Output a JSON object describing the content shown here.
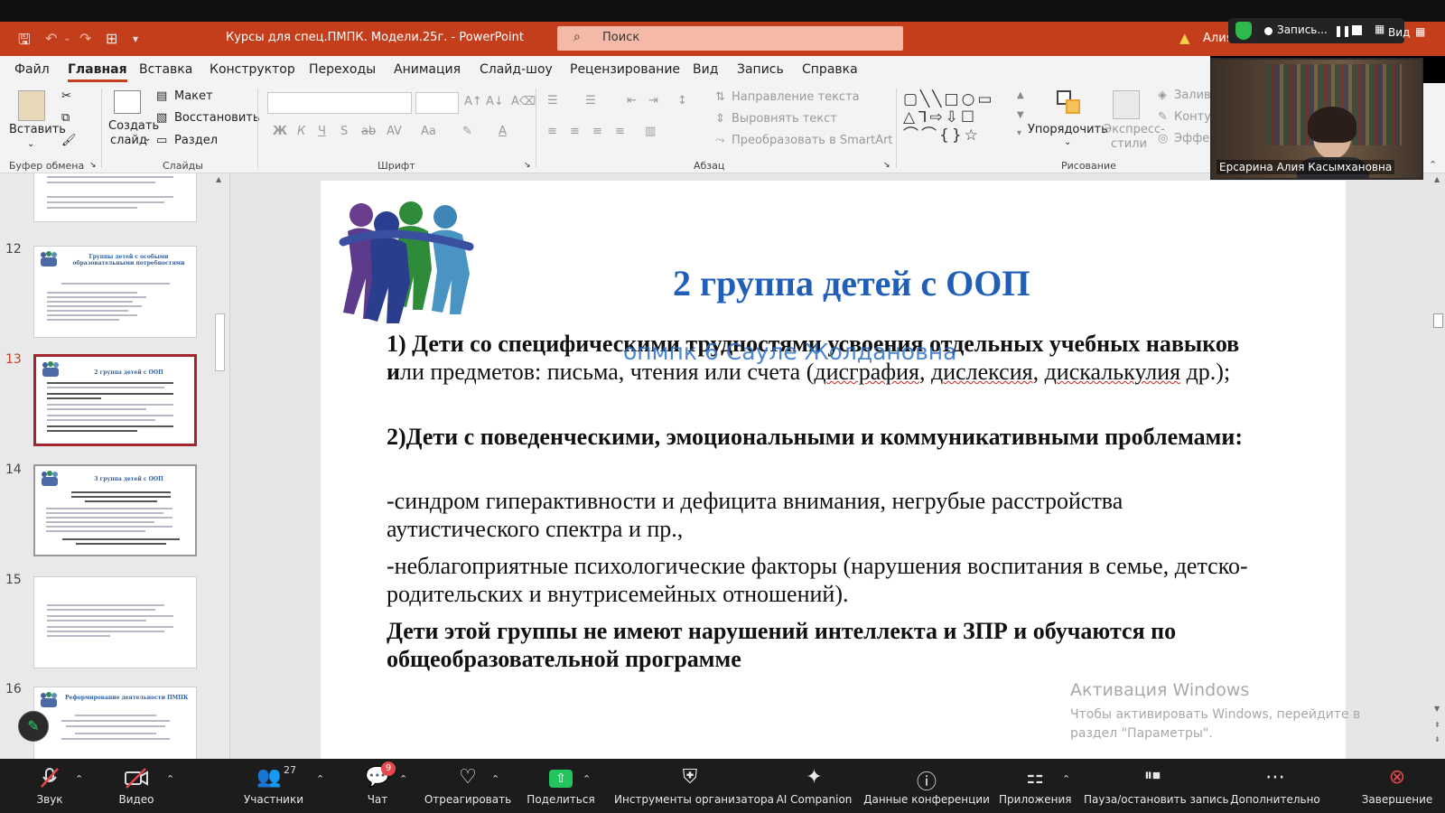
{
  "window": {
    "doc_title": "Курсы для спец.ПМПК. Модели.25г. - PowerPoint",
    "search_placeholder": "Поиск",
    "user": "Алия",
    "accent": "#c43e1c"
  },
  "recording": {
    "label": "Запись...",
    "view_label": "Вид",
    "recording_color": "#2fb84b"
  },
  "menu": {
    "tabs": [
      "Файл",
      "Главная",
      "Вставка",
      "Конструктор",
      "Переходы",
      "Анимация",
      "Слайд-шоу",
      "Рецензирование",
      "Вид",
      "Запись",
      "Справка"
    ],
    "active": "Главная"
  },
  "ribbon": {
    "clipboard": {
      "paste": "Вставить",
      "group": "Буфер обмена"
    },
    "slides": {
      "new_slide_1": "Создать",
      "new_slide_2": "слайд",
      "layout": "Макет",
      "reset": "Восстановить",
      "section": "Раздел",
      "group": "Слайды"
    },
    "font": {
      "group": "Шрифт"
    },
    "paragraph": {
      "text_direction": "Направление текста",
      "align_text": "Выровнять текст",
      "smartart": "Преобразовать в SmartArt",
      "group": "Абзац"
    },
    "drawing": {
      "arrange": "Упорядочить",
      "quick_styles_1": "Экспресс-",
      "quick_styles_2": "стили",
      "fill": "Залив",
      "outline": "Конту",
      "effects": "Эффе",
      "group": "Рисование"
    }
  },
  "thumbnails": [
    {
      "num": "",
      "title": ""
    },
    {
      "num": "12",
      "title": "Группы детей с особыми образовательными потребностями"
    },
    {
      "num": "13",
      "title": "2 группа детей с ООП",
      "active": true
    },
    {
      "num": "14",
      "title": "3 группа детей с ООП"
    },
    {
      "num": "15",
      "title": ""
    },
    {
      "num": "16",
      "title": "Реформирование деятельности ПМПК"
    }
  ],
  "slide": {
    "title": "2 группа детей с ООП",
    "overlay_name": "опмпк 6 Сауле Жолдановна",
    "p1_bold": "1) Дети со специфическими трудностями усвоения отдельных учебных навыков и",
    "p1_rest": "ли предметов: письма, чтения или счета (",
    "p1_w1": "дисграфия",
    "p1_sep": ", ",
    "p1_w2": "дислексия",
    "p1_end": ", ",
    "p1_w3": "дискалькулия",
    "p1_tail": " др.);",
    "p2": "2)Дети с поведенческими, эмоциональными и коммуникативными проблемами:",
    "p3": "-синдром гиперактивности и дефицита внимания, негрубые расстройства аутистического спектра и пр.,",
    "p4": "-неблагоприятные   психологические факторы (нарушения воспитания в семье, детско-родительских и внутрисемейных отношений).",
    "p5": "Дети этой группы не имеют нарушений интеллекта и ЗПР и обучаются по общеобразовательной программе"
  },
  "activation": {
    "title": "Активация Windows",
    "subtitle": "Чтобы активировать Windows, перейдите в раздел \"Параметры\"."
  },
  "webcam": {
    "name": "Ерсарина Алия Касымхановна"
  },
  "zoom_toolbar": {
    "audio": "Звук",
    "video": "Видео",
    "participants": "Участники",
    "participants_count": "27",
    "chat": "Чат",
    "chat_badge": "9",
    "react": "Отреагировать",
    "share": "Поделиться",
    "host_tools": "Инструменты организатора",
    "ai": "AI Companion",
    "meeting_info": "Данные конференции",
    "apps": "Приложения",
    "pause_record": "Пауза/остановить запись",
    "more": "Дополнительно",
    "end": "Завершение"
  }
}
